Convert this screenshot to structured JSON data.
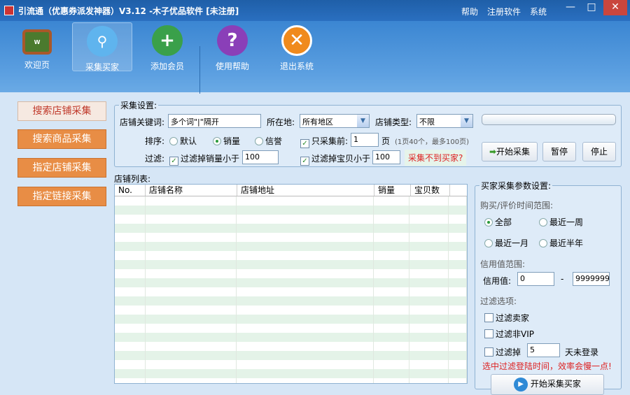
{
  "window": {
    "title": "引流通（优惠券派发神器）V3.12 -木子优品软件 [未注册]",
    "menu": [
      "帮助",
      "注册软件",
      "系统"
    ],
    "controls": [
      "—",
      "□",
      "✕"
    ]
  },
  "toolbar": [
    {
      "label": "欢迎页",
      "icon": "welcome-board-icon"
    },
    {
      "label": "采集买家",
      "icon": "users-search-icon"
    },
    {
      "label": "添加会员",
      "icon": "add-user-icon"
    },
    {
      "label": "使用帮助",
      "icon": "help-icon"
    },
    {
      "label": "退出系统",
      "icon": "exit-icon"
    }
  ],
  "sidebar": [
    "搜索店铺采集",
    "搜索商品采集",
    "指定店铺采集",
    "指定链接采集"
  ],
  "settings": {
    "legend": "采集设置:",
    "keyword_label": "店铺关键词:",
    "keyword_value": "多个词\"|\"隔开",
    "location_label": "所在地:",
    "location_value": "所有地区",
    "type_label": "店铺类型:",
    "type_value": "不限",
    "sort_label": "排序:",
    "sort_options": [
      "默认",
      "销量",
      "信誉"
    ],
    "only_first_label": "只采集前:",
    "only_first_value": "1",
    "page_unit": "页",
    "page_hint": "(1页40个，最多100页)",
    "filter_label": "过滤:",
    "filter_sales_label": "过滤掉销量小于",
    "filter_sales_value": "100",
    "filter_items_label": "过滤掉宝贝小于",
    "filter_items_value": "100",
    "help_link": "采集不到买家?",
    "start": "开始采集",
    "pause": "暂停",
    "stop": "停止"
  },
  "list": {
    "title": "店铺列表:",
    "columns": [
      "No.",
      "店铺名称",
      "店铺地址",
      "销量",
      "宝贝数"
    ]
  },
  "buyer": {
    "legend": "买家采集参数设置:",
    "time_label": "购买/评价时间范围:",
    "time_options": [
      "全部",
      "最近一周",
      "最近一月",
      "最近半年"
    ],
    "credit_label": "信用值范围:",
    "credit_field_label": "信用值:",
    "credit_min": "0",
    "dash": "-",
    "credit_max": "9999999",
    "filter_label": "过滤选项:",
    "filter_seller": "过滤卖家",
    "filter_nonvip": "过滤非VIP",
    "filter_days_pre": "过滤掉",
    "filter_days_value": "5",
    "filter_days_post": "天未登录",
    "warning": "选中过滤登陆时间，效率会慢一点!",
    "start": "开始采集买家"
  }
}
